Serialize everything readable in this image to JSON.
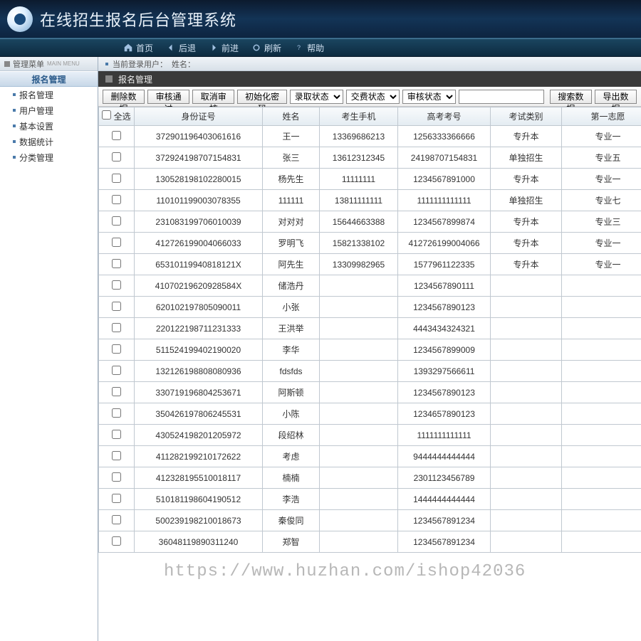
{
  "header": {
    "title": "在线招生报名后台管理系统"
  },
  "navbar": {
    "home": "首页",
    "back": "后退",
    "forward": "前进",
    "refresh": "刷新",
    "help": "帮助"
  },
  "sidebar": {
    "header_label": "管理菜单",
    "header_sub": "MAIN MENU",
    "group_title": "报名管理",
    "items": [
      {
        "label": "报名管理"
      },
      {
        "label": "用户管理"
      },
      {
        "label": "基本设置"
      },
      {
        "label": "数据统计"
      },
      {
        "label": "分类管理"
      }
    ]
  },
  "topbar": {
    "user_prefix": "当前登录用户：",
    "name_prefix": "姓名："
  },
  "content_title": "报名管理",
  "toolbar": {
    "delete": "删除数据",
    "approve": "审核通过",
    "cancel_approve": "取消审核",
    "init_pwd": "初始化密码",
    "sel_admit": "录取状态",
    "sel_pay": "交费状态",
    "sel_audit": "审核状态",
    "search": "搜索数据",
    "export": "导出数据"
  },
  "table": {
    "select_all": "全选",
    "columns": [
      "身份证号",
      "姓名",
      "考生手机",
      "高考考号",
      "考试类别",
      "第一志愿"
    ],
    "rows": [
      {
        "id": "372901196403061616",
        "name": "王一",
        "phone": "13369686213",
        "exam": "1256333366666",
        "type": "专升本",
        "wish": "专业一"
      },
      {
        "id": "372924198707154831",
        "name": "张三",
        "phone": "13612312345",
        "exam": "24198707154831",
        "type": "单独招生",
        "wish": "专业五"
      },
      {
        "id": "130528198102280015",
        "name": "杨先生",
        "phone": "11111111",
        "exam": "1234567891000",
        "type": "专升本",
        "wish": "专业一"
      },
      {
        "id": "110101199003078355",
        "name": "111111",
        "phone": "13811111111",
        "exam": "1111111111111",
        "type": "单独招生",
        "wish": "专业七"
      },
      {
        "id": "231083199706010039",
        "name": "对对对",
        "phone": "15644663388",
        "exam": "1234567899874",
        "type": "专升本",
        "wish": "专业三"
      },
      {
        "id": "412726199004066033",
        "name": "罗明飞",
        "phone": "15821338102",
        "exam": "412726199004066",
        "type": "专升本",
        "wish": "专业一"
      },
      {
        "id": "65310119940818121X",
        "name": "阿先生",
        "phone": "13309982965",
        "exam": "1577961122335",
        "type": "专升本",
        "wish": "专业一"
      },
      {
        "id": "41070219620928584X",
        "name": "储浩丹",
        "phone": "",
        "exam": "1234567890111",
        "type": "",
        "wish": ""
      },
      {
        "id": "620102197805090011",
        "name": "小张",
        "phone": "",
        "exam": "1234567890123",
        "type": "",
        "wish": ""
      },
      {
        "id": "220122198711231333",
        "name": "王洪举",
        "phone": "",
        "exam": "4443434324321",
        "type": "",
        "wish": ""
      },
      {
        "id": "511524199402190020",
        "name": "李华",
        "phone": "",
        "exam": "1234567899009",
        "type": "",
        "wish": ""
      },
      {
        "id": "132126198808080936",
        "name": "fdsfds",
        "phone": "",
        "exam": "1393297566611",
        "type": "",
        "wish": ""
      },
      {
        "id": "330719196804253671",
        "name": "阿斯顿",
        "phone": "",
        "exam": "1234567890123",
        "type": "",
        "wish": ""
      },
      {
        "id": "350426197806245531",
        "name": "小陈",
        "phone": "",
        "exam": "1234657890123",
        "type": "",
        "wish": ""
      },
      {
        "id": "430524198201205972",
        "name": "段绍林",
        "phone": "",
        "exam": "1111111111111",
        "type": "",
        "wish": ""
      },
      {
        "id": "411282199210172622",
        "name": "考虑",
        "phone": "",
        "exam": "9444444444444",
        "type": "",
        "wish": ""
      },
      {
        "id": "412328195510018117",
        "name": "楠楠",
        "phone": "",
        "exam": "2301123456789",
        "type": "",
        "wish": ""
      },
      {
        "id": "510181198604190512",
        "name": "李浩",
        "phone": "",
        "exam": "1444444444444",
        "type": "",
        "wish": ""
      },
      {
        "id": "500239198210018673",
        "name": "秦俊同",
        "phone": "",
        "exam": "1234567891234",
        "type": "",
        "wish": ""
      },
      {
        "id": "36048119890311240",
        "name": "郑智",
        "phone": "",
        "exam": "1234567891234",
        "type": "",
        "wish": ""
      }
    ]
  },
  "watermark": "https://www.huzhan.com/ishop42036"
}
